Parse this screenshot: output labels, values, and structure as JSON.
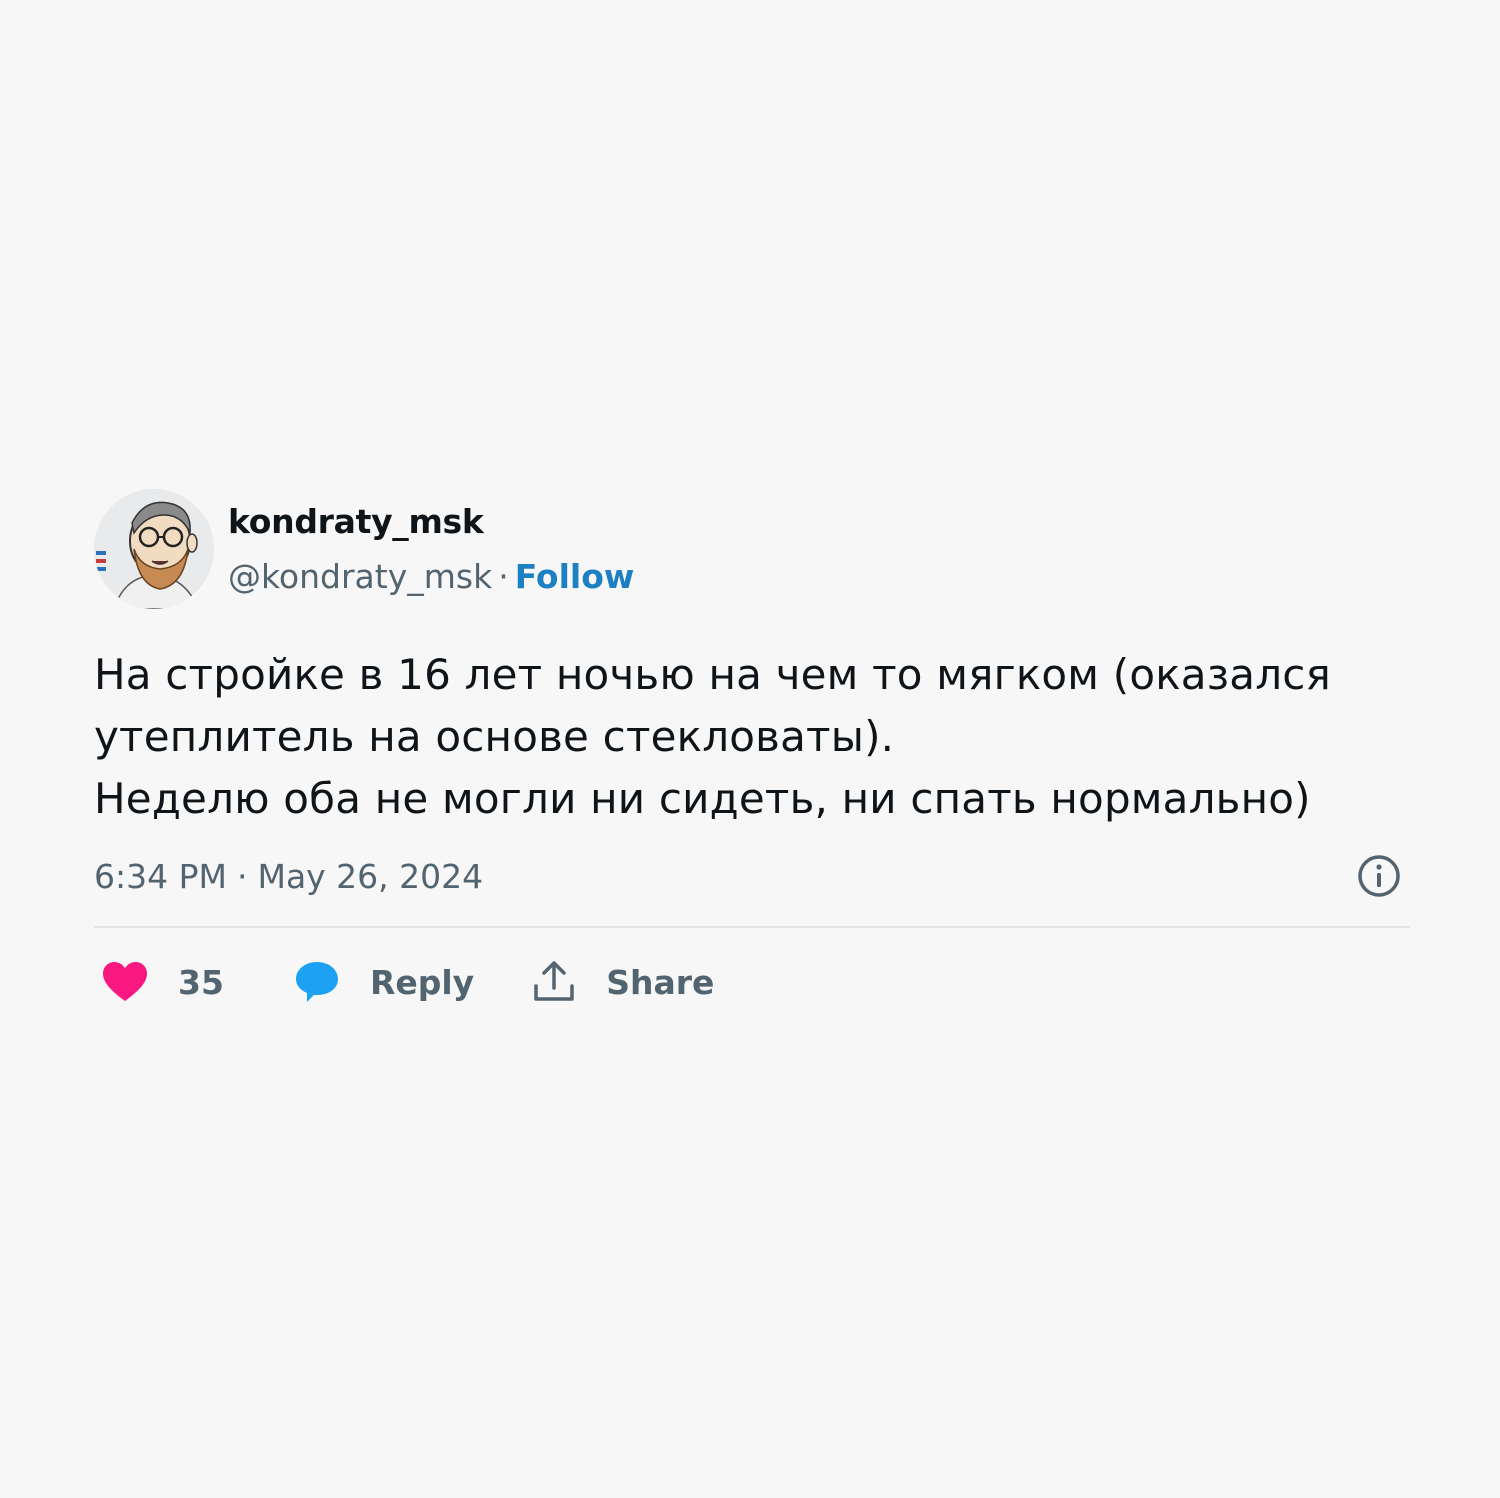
{
  "author": {
    "display_name": "kondraty_msk",
    "handle": "@kondraty_msk",
    "separator": "·",
    "follow_label": "Follow"
  },
  "tweet": {
    "line1": "На стройке в 16 лет ночью на чем то мягком (оказался",
    "line2": "утеплитель на основе стекловаты).",
    "line3": "Неделю оба не могли ни сидеть, ни спать нормально)",
    "time": "6:34 PM",
    "separator": "·",
    "date": "May 26, 2024"
  },
  "actions": {
    "like_count": "35",
    "reply_label": "Reply",
    "share_label": "Share"
  },
  "colors": {
    "background": "#f7f7f7",
    "follow": "#1d80c3",
    "like": "#f91880",
    "reply": "#1da1f2",
    "muted": "#536471"
  },
  "icons": {
    "info": "info-icon",
    "like": "heart-icon",
    "reply": "speech-bubble-icon",
    "share": "share-upload-icon"
  }
}
